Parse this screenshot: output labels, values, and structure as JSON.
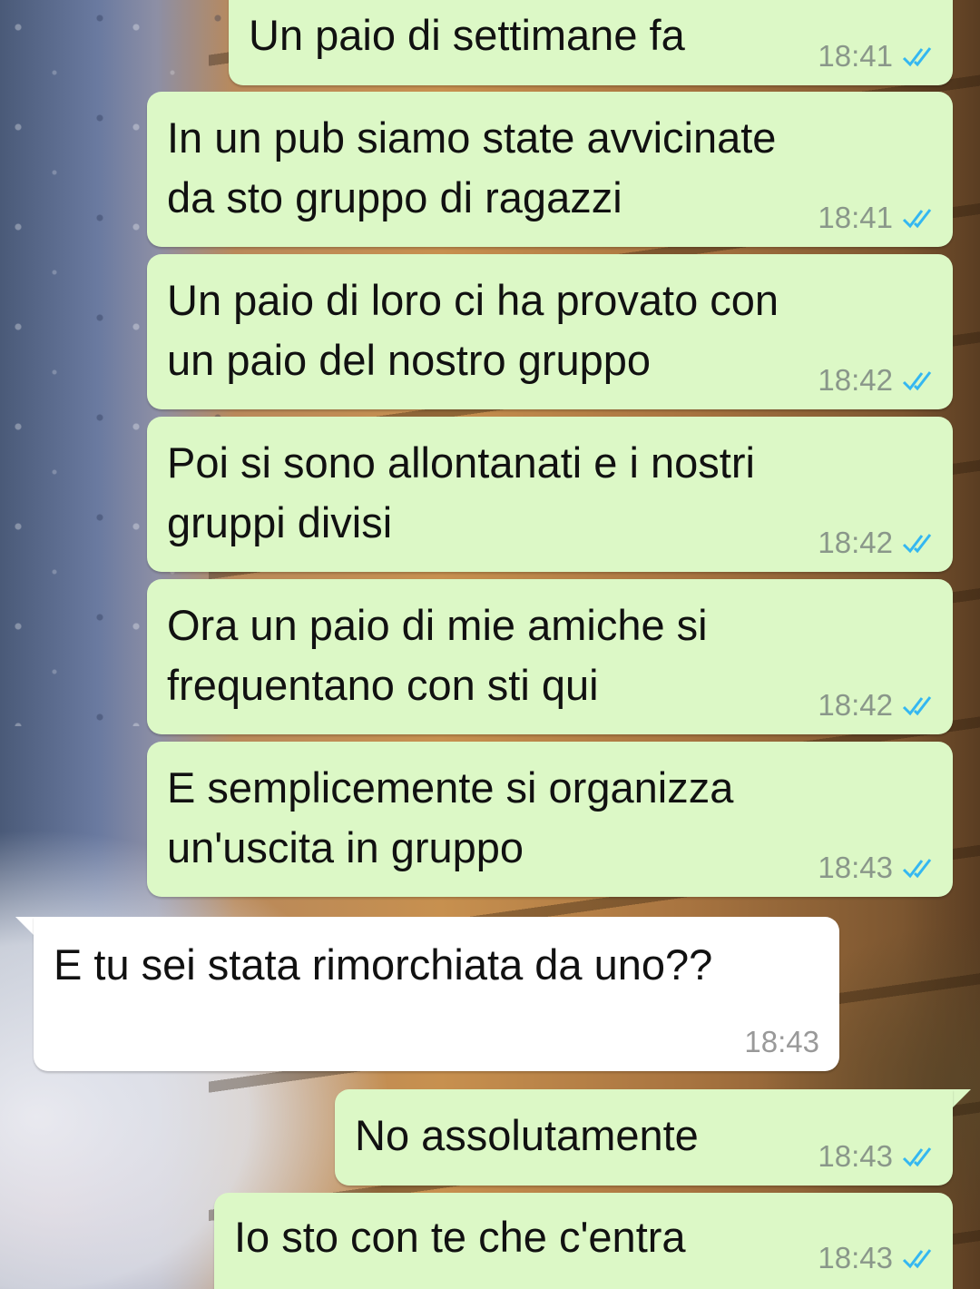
{
  "chat": {
    "messages": [
      {
        "direction": "outgoing",
        "lines": [
          "Un paio di settimane fa"
        ],
        "time": "18:41",
        "status": "read"
      },
      {
        "direction": "outgoing",
        "lines": [
          "In un pub siamo state avvicinate",
          "da sto gruppo di ragazzi"
        ],
        "time": "18:41",
        "status": "read"
      },
      {
        "direction": "outgoing",
        "lines": [
          "Un paio di loro ci ha provato con",
          "un paio del nostro gruppo"
        ],
        "time": "18:42",
        "status": "read"
      },
      {
        "direction": "outgoing",
        "lines": [
          "Poi si sono allontanati e i nostri",
          "gruppi divisi"
        ],
        "time": "18:42",
        "status": "read"
      },
      {
        "direction": "outgoing",
        "lines": [
          "Ora un paio di mie amiche si",
          "frequentano con sti qui"
        ],
        "time": "18:42",
        "status": "read"
      },
      {
        "direction": "outgoing",
        "lines": [
          "E semplicemente si organizza",
          "un'uscita in gruppo"
        ],
        "time": "18:43",
        "status": "read"
      },
      {
        "direction": "incoming",
        "lines": [
          "E tu sei stata rimorchiata da uno??"
        ],
        "time": "18:43"
      },
      {
        "direction": "outgoing",
        "lines": [
          "No assolutamente"
        ],
        "time": "18:43",
        "status": "read"
      },
      {
        "direction": "outgoing",
        "lines": [
          "Io sto con te che c'entra"
        ],
        "time": "18:43",
        "status": "read"
      }
    ]
  },
  "colors": {
    "outgoing_bubble": "#dcf8c6",
    "incoming_bubble": "#ffffff",
    "read_tick": "#34b7f1",
    "timestamp": "#8a978a"
  },
  "icons": {
    "read_receipt": "double-check-icon"
  }
}
